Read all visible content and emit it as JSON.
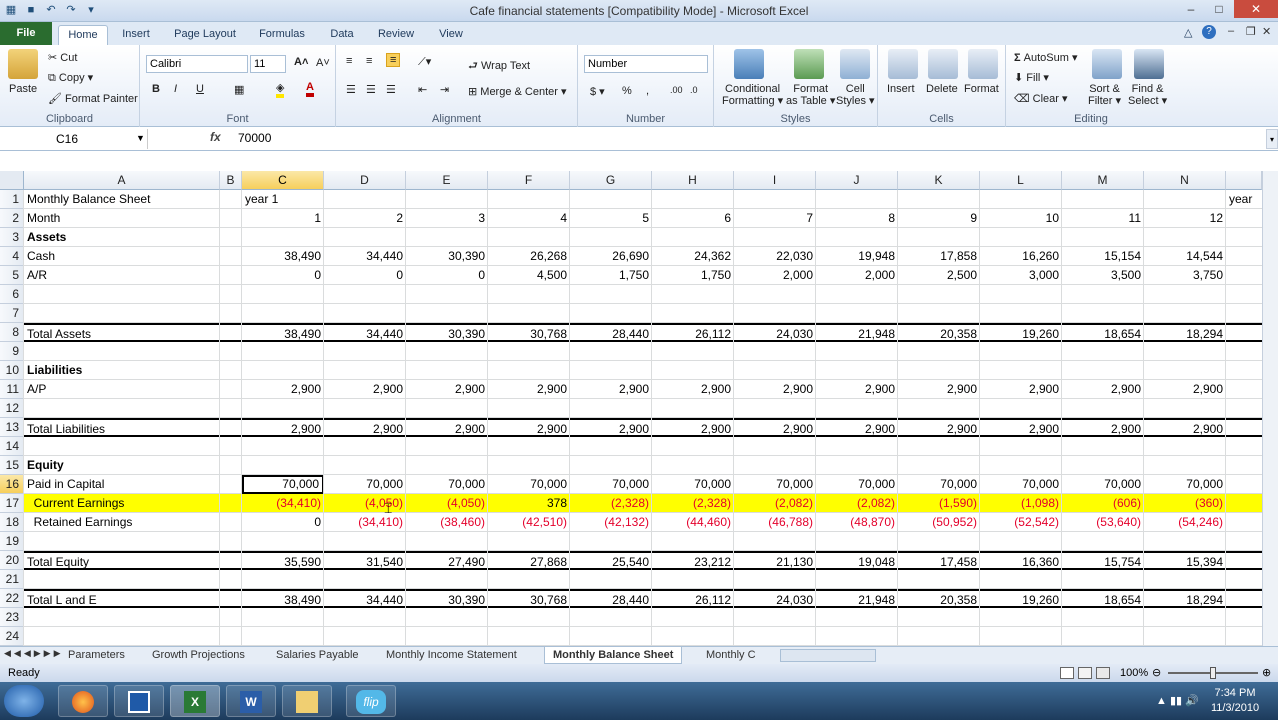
{
  "window": {
    "title": "Cafe financial statements  [Compatibility Mode] - Microsoft Excel"
  },
  "tabs": [
    "File",
    "Home",
    "Insert",
    "Page Layout",
    "Formulas",
    "Data",
    "Review",
    "View"
  ],
  "ribbon": {
    "clipboard": {
      "label": "Clipboard",
      "paste": "Paste",
      "cut": "Cut",
      "copy": "Copy",
      "format_painter": "Format Painter"
    },
    "font": {
      "label": "Font",
      "name": "Calibri",
      "size": "11"
    },
    "alignment": {
      "label": "Alignment",
      "wrap": "Wrap Text",
      "merge": "Merge & Center"
    },
    "number": {
      "label": "Number",
      "format": "Number"
    },
    "styles": {
      "label": "Styles",
      "conditional": "Conditional",
      "conditional2": "Formatting",
      "format_as": "Format",
      "format_as2": "as Table",
      "cell": "Cell",
      "cell2": "Styles"
    },
    "cells": {
      "label": "Cells",
      "insert": "Insert",
      "delete": "Delete",
      "format": "Format"
    },
    "editing": {
      "label": "Editing",
      "autosum": "AutoSum",
      "fill": "Fill",
      "clear": "Clear",
      "sort": "Sort &",
      "sort2": "Filter",
      "find": "Find &",
      "find2": "Select"
    }
  },
  "formula_bar": {
    "name_box": "C16",
    "fx": "fx",
    "value": "70000"
  },
  "columns": [
    "A",
    "B",
    "C",
    "D",
    "E",
    "F",
    "G",
    "H",
    "I",
    "J",
    "K",
    "L",
    "M",
    "N"
  ],
  "rows": [
    {
      "n": "1",
      "a": "Monthly Balance Sheet",
      "b": "",
      "v": [
        "year 1",
        "",
        "",
        "",
        "",
        "",
        "",
        "",
        "",
        "",
        "",
        ""
      ],
      "extra": "year"
    },
    {
      "n": "2",
      "a": "Month",
      "v": [
        "1",
        "2",
        "3",
        "4",
        "5",
        "6",
        "7",
        "8",
        "9",
        "10",
        "11",
        "12"
      ]
    },
    {
      "n": "3",
      "a": "Assets",
      "bold": true,
      "v": []
    },
    {
      "n": "4",
      "a": "Cash",
      "v": [
        "38,490",
        "34,440",
        "30,390",
        "26,268",
        "26,690",
        "24,362",
        "22,030",
        "19,948",
        "17,858",
        "16,260",
        "15,154",
        "14,544"
      ]
    },
    {
      "n": "5",
      "a": "A/R",
      "v": [
        "0",
        "0",
        "0",
        "4,500",
        "1,750",
        "1,750",
        "2,000",
        "2,000",
        "2,500",
        "3,000",
        "3,500",
        "3,750"
      ]
    },
    {
      "n": "6",
      "a": "",
      "v": []
    },
    {
      "n": "7",
      "a": "",
      "v": []
    },
    {
      "n": "8",
      "a": "Total Assets",
      "v": [
        "38,490",
        "34,440",
        "30,390",
        "30,768",
        "28,440",
        "26,112",
        "24,030",
        "21,948",
        "20,358",
        "19,260",
        "18,654",
        "18,294"
      ]
    },
    {
      "n": "9",
      "a": "",
      "v": []
    },
    {
      "n": "10",
      "a": "Liabilities",
      "bold": true,
      "v": []
    },
    {
      "n": "11",
      "a": "A/P",
      "v": [
        "2,900",
        "2,900",
        "2,900",
        "2,900",
        "2,900",
        "2,900",
        "2,900",
        "2,900",
        "2,900",
        "2,900",
        "2,900",
        "2,900"
      ]
    },
    {
      "n": "12",
      "a": "",
      "v": []
    },
    {
      "n": "13",
      "a": "Total Liabilities",
      "v": [
        "2,900",
        "2,900",
        "2,900",
        "2,900",
        "2,900",
        "2,900",
        "2,900",
        "2,900",
        "2,900",
        "2,900",
        "2,900",
        "2,900"
      ]
    },
    {
      "n": "14",
      "a": "",
      "v": []
    },
    {
      "n": "15",
      "a": "Equity",
      "bold": true,
      "v": []
    },
    {
      "n": "16",
      "a": "Paid in Capital",
      "v": [
        "70,000",
        "70,000",
        "70,000",
        "70,000",
        "70,000",
        "70,000",
        "70,000",
        "70,000",
        "70,000",
        "70,000",
        "70,000",
        "70,000"
      ]
    },
    {
      "n": "17",
      "a": "  Current Earnings",
      "v": [
        "(34,410)",
        "(4,050)",
        "(4,050)",
        "378",
        "(2,328)",
        "(2,328)",
        "(2,082)",
        "(2,082)",
        "(1,590)",
        "(1,098)",
        "(606)",
        "(360)"
      ]
    },
    {
      "n": "18",
      "a": "  Retained Earnings",
      "v": [
        "0",
        "(34,410)",
        "(38,460)",
        "(42,510)",
        "(42,132)",
        "(44,460)",
        "(46,788)",
        "(48,870)",
        "(50,952)",
        "(52,542)",
        "(53,640)",
        "(54,246)"
      ]
    },
    {
      "n": "19",
      "a": "",
      "v": []
    },
    {
      "n": "20",
      "a": "Total Equity",
      "v": [
        "35,590",
        "31,540",
        "27,490",
        "27,868",
        "25,540",
        "23,212",
        "21,130",
        "19,048",
        "17,458",
        "16,360",
        "15,754",
        "15,394"
      ]
    },
    {
      "n": "21",
      "a": "",
      "v": []
    },
    {
      "n": "22",
      "a": "Total L and E",
      "v": [
        "38,490",
        "34,440",
        "30,390",
        "30,768",
        "28,440",
        "26,112",
        "24,030",
        "21,948",
        "20,358",
        "19,260",
        "18,654",
        "18,294"
      ]
    },
    {
      "n": "23",
      "a": "",
      "v": []
    },
    {
      "n": "24",
      "a": "",
      "v": []
    }
  ],
  "sheet_tabs": [
    "Parameters",
    "Growth Projections",
    "Salaries Payable",
    "Monthly Income Statement",
    "Monthly Balance Sheet",
    "Monthly C"
  ],
  "active_sheet": "Monthly Balance Sheet",
  "status": {
    "ready": "Ready",
    "zoom": "100%"
  },
  "clock": {
    "time": "7:34 PM",
    "date": "11/3/2010"
  },
  "taskbar_apps": [
    "windows-start-icon",
    "firefox-icon",
    "app-icon",
    "excel-icon",
    "word-icon",
    "folder-icon",
    "flip-icon"
  ]
}
